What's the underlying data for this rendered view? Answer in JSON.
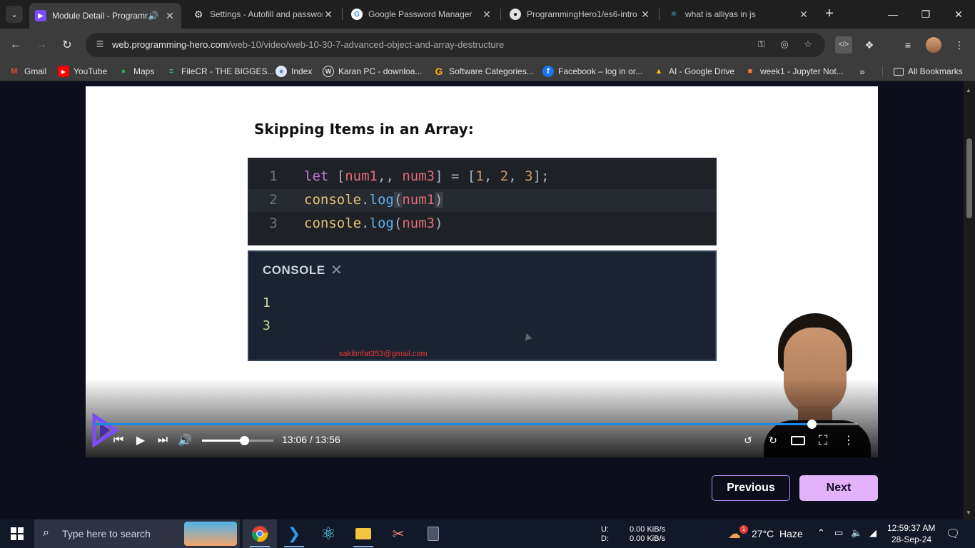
{
  "browser": {
    "tabs": [
      {
        "title": "Module Detail - Programming Hero",
        "icon": "programming-hero-favicon",
        "active": true,
        "audio": true
      },
      {
        "title": "Settings - Autofill and passwords",
        "icon": "gear-icon"
      },
      {
        "title": "Google Password Manager",
        "icon": "google-icon"
      },
      {
        "title": "ProgrammingHero1/es6-intro",
        "icon": "github-icon"
      },
      {
        "title": "what is alliyas in js",
        "icon": "react-icon"
      }
    ],
    "url_host": "web.programming-hero.com",
    "url_path": "/web-10/video/web-10-30-7-advanced-object-and-array-destructure",
    "bookmarks": [
      {
        "label": "Gmail",
        "icon": "gmail-icon"
      },
      {
        "label": "YouTube",
        "icon": "youtube-icon"
      },
      {
        "label": "Maps",
        "icon": "maps-icon"
      },
      {
        "label": "FileCR - THE BIGGES...",
        "icon": "filecr-icon"
      },
      {
        "label": "Index",
        "icon": "index-icon"
      },
      {
        "label": "Karan PC - downloa...",
        "icon": "wordpress-icon"
      },
      {
        "label": "Software Categories...",
        "icon": "g-icon"
      },
      {
        "label": "Facebook – log in or...",
        "icon": "facebook-icon"
      },
      {
        "label": "AI - Google Drive",
        "icon": "drive-icon"
      },
      {
        "label": "week1 - Jupyter Not...",
        "icon": "jupyter-icon"
      }
    ],
    "all_bookmarks": "All Bookmarks"
  },
  "slide": {
    "title": "Skipping Items in an Array:",
    "code_lines": [
      {
        "num": "1",
        "text": "let [num1,, num3] = [1, 2, 3];"
      },
      {
        "num": "2",
        "text": "console.log(num1)"
      },
      {
        "num": "3",
        "text": "console.log(num3)"
      }
    ],
    "console_label": "CONSOLE",
    "console_output": [
      "1",
      "3"
    ],
    "watermark": "sakibrifat353@gmail.com"
  },
  "player": {
    "current_time": "13:06",
    "duration": "13:56",
    "time_display": "13:06 / 13:56",
    "progress_fraction": 0.94,
    "volume_fraction": 0.59,
    "accent": "#1e88e5"
  },
  "nav": {
    "previous": "Previous",
    "next": "Next"
  },
  "taskbar": {
    "search_placeholder": "Type here to search",
    "net_up_label": "U:",
    "net_down_label": "D:",
    "net_up": "0.00 KiB/s",
    "net_down": "0.00 KiB/s",
    "weather": "27°C  Haze",
    "weather_badge": "1",
    "time": "12:59:37 AM",
    "date": "28-Sep-24"
  }
}
